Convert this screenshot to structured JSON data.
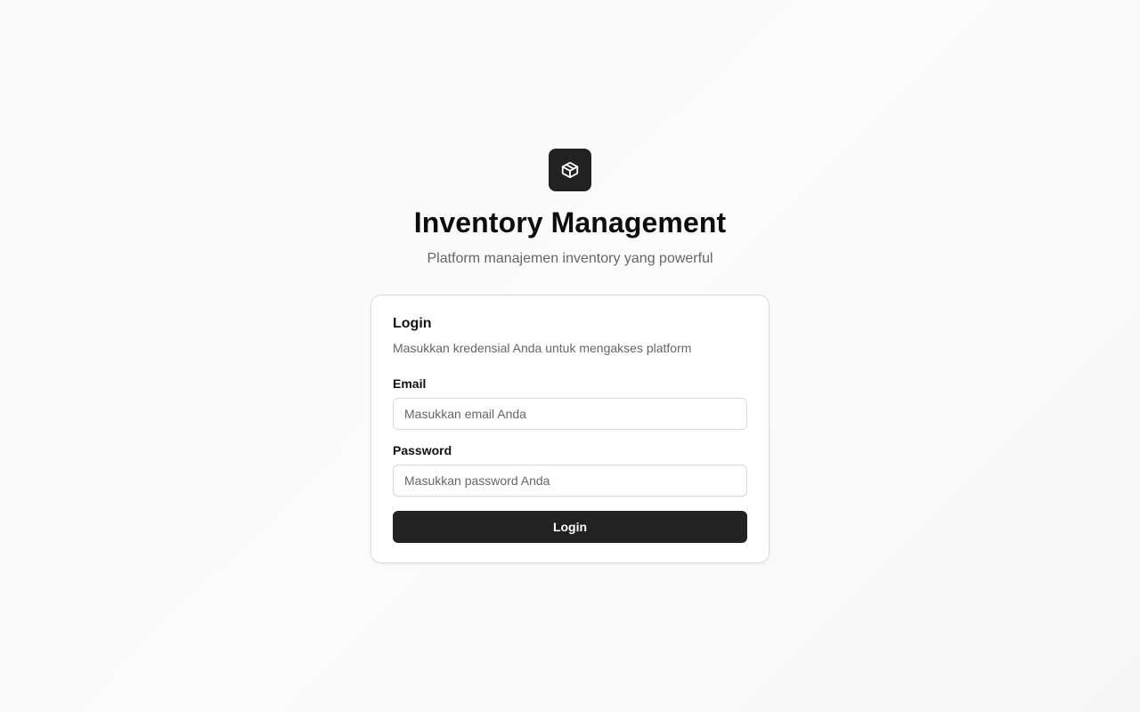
{
  "app": {
    "title": "Inventory Management",
    "subtitle": "Platform manajemen inventory yang powerful",
    "logo_icon": "package-icon"
  },
  "login_card": {
    "title": "Login",
    "description": "Masukkan kredensial Anda untuk mengakses platform",
    "email": {
      "label": "Email",
      "placeholder": "Masukkan email Anda",
      "value": ""
    },
    "password": {
      "label": "Password",
      "placeholder": "Masukkan password Anda",
      "value": ""
    },
    "submit_label": "Login"
  },
  "colors": {
    "background": "#f9f9f9",
    "primary": "#222222",
    "text": "#111111",
    "muted_text": "#666666",
    "border": "#dcdcdc"
  }
}
